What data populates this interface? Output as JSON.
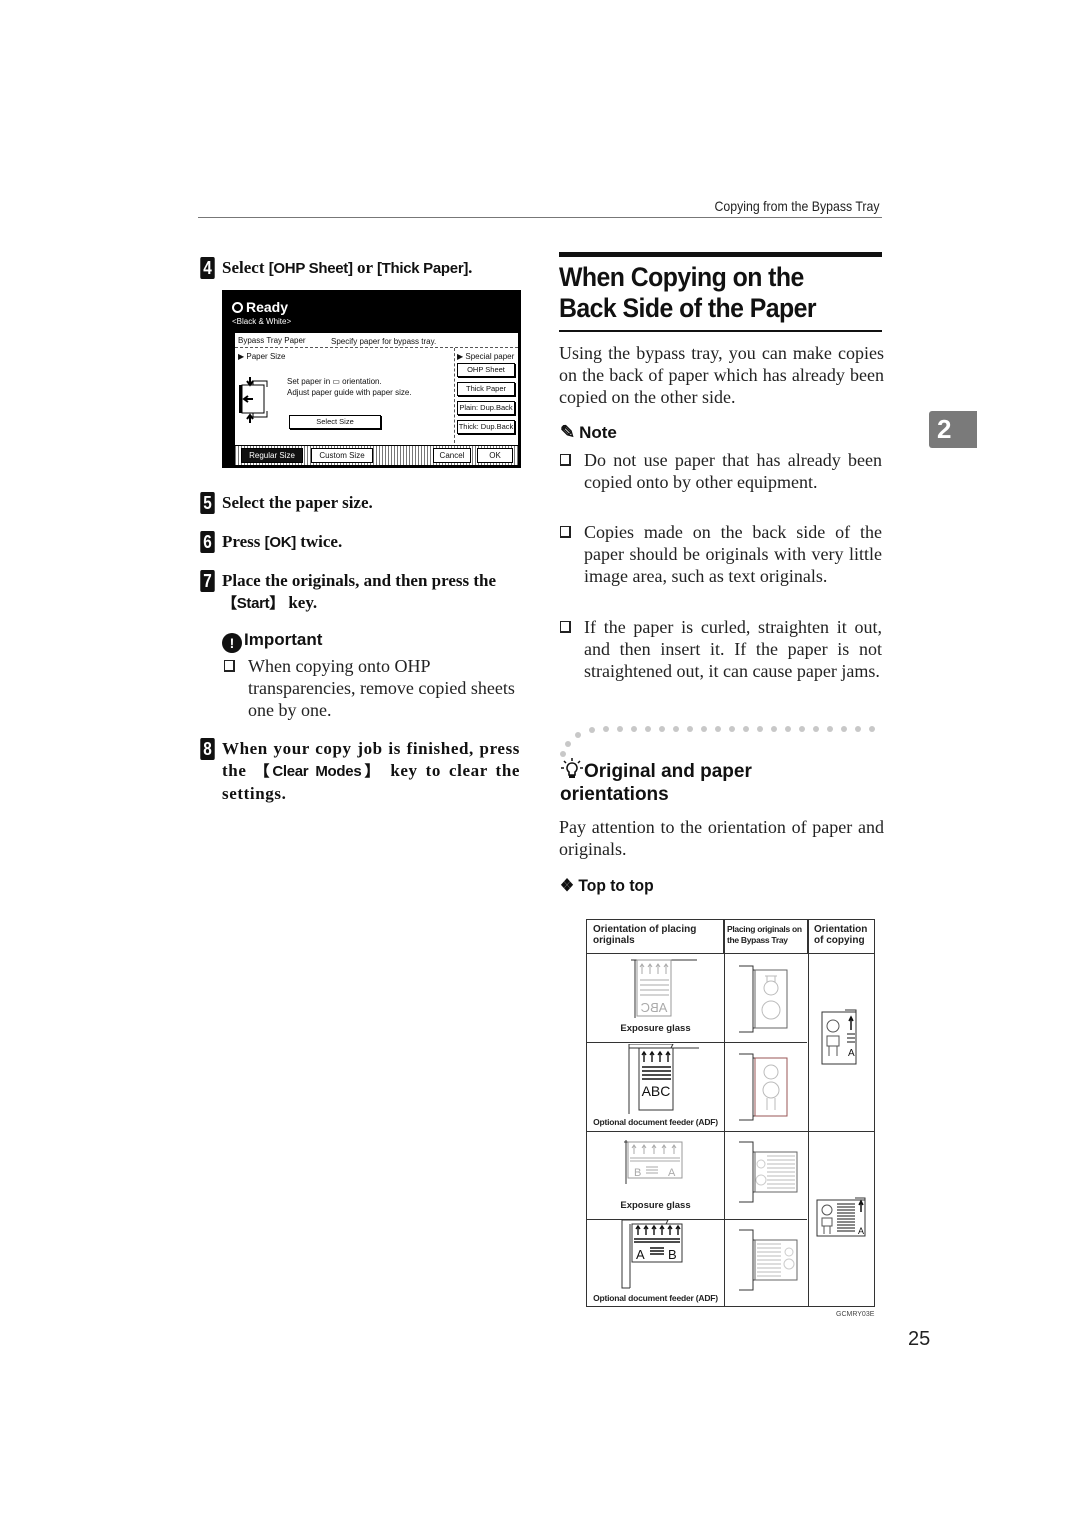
{
  "running_header": "Copying from the Bypass Tray",
  "left_column": {
    "step4": {
      "number": "4",
      "prefix": "Select ",
      "key1": "[OHP Sheet]",
      "middle": " or ",
      "key2": "[Thick Paper]",
      "suffix": "."
    },
    "lcd": {
      "status": "Ready",
      "mode": "<Black & White>",
      "panel_title": "Bypass Tray Paper",
      "panel_instruction": "Specify paper for bypass tray.",
      "paper_size_label": "▶ Paper Size",
      "special_paper_label": "▶ Special paper",
      "message_line1": "Set paper in ▭ orientation.",
      "message_line2": "Adjust paper guide with paper size.",
      "select_size_button": "Select Size",
      "special_buttons": [
        "OHP Sheet",
        "Thick Paper",
        "Plain: Dup.Back",
        "Thick: Dup.Back"
      ],
      "bottom_buttons": {
        "regular_size": "Regular Size",
        "custom_size": "Custom Size",
        "cancel": "Cancel",
        "ok": "OK"
      }
    },
    "step5": {
      "number": "5",
      "text": "Select the paper size."
    },
    "step6": {
      "number": "6",
      "prefix": "Press ",
      "key": "[OK]",
      "suffix": " twice."
    },
    "step7": {
      "number": "7",
      "prefix": "Place the originals, and then press the ",
      "key": "【Start】",
      "suffix": " key."
    },
    "important": {
      "heading": "Important",
      "icon": "exclamation-badge-icon",
      "items": [
        "When copying onto OHP transparencies, remove copied sheets one by one."
      ]
    },
    "step8": {
      "number": "8",
      "prefix": "When your copy job is finished, press the ",
      "key": "【Clear Modes】",
      "suffix": " key to clear the settings."
    }
  },
  "right_column": {
    "section_title": "When Copying on the Back Side of the Paper",
    "intro": "Using the bypass tray, you can make copies on the back of paper which has already been copied on the other side.",
    "note": {
      "heading": "Note",
      "icon": "pencil-icon",
      "items": [
        "Do not use paper that has already been copied onto by other equipment.",
        "Copies made on the back side of the paper should be originals with very little image area, such as text originals.",
        "If the paper is curled, straighten it out, and then insert it. If the paper is not straightened out, it can cause paper jams."
      ]
    },
    "tip": {
      "icon": "lightbulb-icon",
      "heading": "Original and paper orientations",
      "text": "Pay attention to the orientation of paper and originals."
    },
    "subheading": "❖ Top to top",
    "figure": {
      "headers": [
        "Orientation of placing originals",
        "Placing originals on the Bypass Tray",
        "Orientation of copying"
      ],
      "row_labels": [
        "Exposure glass",
        "Optional document feeder (ADF)",
        "Exposure glass",
        "Optional document feeder (ADF)"
      ],
      "glyphs": {
        "abc": "ABC",
        "a": "A",
        "b": "B"
      },
      "code": "GCMRY03E"
    }
  },
  "chapter_tab": "2",
  "page_number": "25"
}
